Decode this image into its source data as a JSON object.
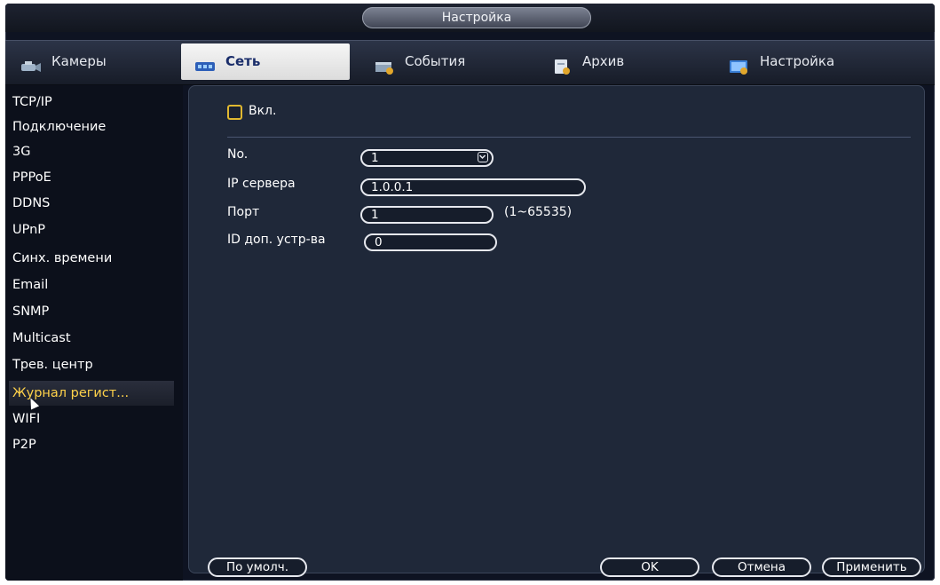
{
  "window": {
    "title": "Настройка"
  },
  "tabs": [
    {
      "label": "Камеры",
      "icon": "camera-icon"
    },
    {
      "label": "Сеть",
      "icon": "network-icon",
      "active": true
    },
    {
      "label": "События",
      "icon": "events-icon"
    },
    {
      "label": "Архив",
      "icon": "archive-icon"
    },
    {
      "label": "Настройка",
      "icon": "settings-icon"
    }
  ],
  "sidebar": {
    "items": [
      {
        "label": "TCP/IP"
      },
      {
        "label": "Подключение"
      },
      {
        "label": "3G"
      },
      {
        "label": "PPPoE"
      },
      {
        "label": "DDNS"
      },
      {
        "label": "UPnP"
      },
      {
        "label": "Синх. времени"
      },
      {
        "label": "Email"
      },
      {
        "label": "SNMP"
      },
      {
        "label": "Multicast"
      },
      {
        "label": "Трев. центр"
      },
      {
        "label": "Журнал регист...",
        "active": true
      },
      {
        "label": "WIFI"
      },
      {
        "label": "P2P"
      }
    ]
  },
  "form": {
    "enable_label": "Вкл.",
    "enabled": false,
    "no_label": "No.",
    "no_value": "1",
    "server_ip_label": "IP сервера",
    "server_ip_value": "1.0.0.1",
    "port_label": "Порт",
    "port_value": "1",
    "port_range": "(1~65535)",
    "device_id_label": "ID доп. устр-ва",
    "device_id_value": "0"
  },
  "footer": {
    "default_label": "По умолч.",
    "ok_label": "OK",
    "cancel_label": "Отмена",
    "apply_label": "Применить"
  },
  "colors": {
    "accent_yellow": "#ffd24a",
    "panel_bg": "#1f2839",
    "frame_bg": "#0e1322"
  }
}
